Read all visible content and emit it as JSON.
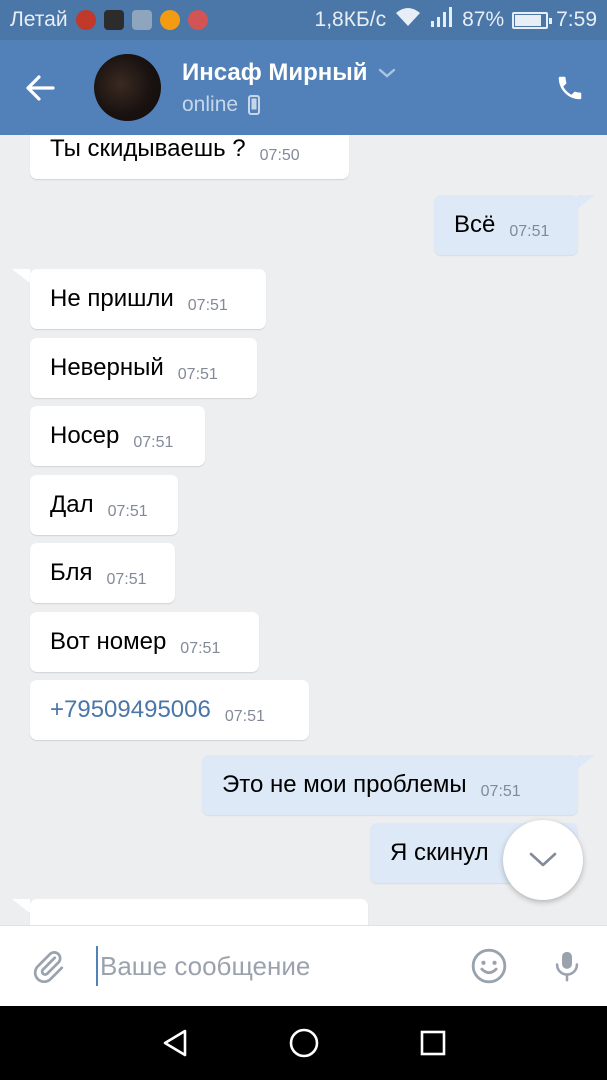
{
  "status_bar": {
    "carrier": "Летай",
    "network_speed": "1,8КБ/с",
    "battery_percent": "87%",
    "battery_level": 0.87,
    "time": "7:59"
  },
  "header": {
    "contact_name": "Инсаф Мирный",
    "status": "online"
  },
  "messages": [
    {
      "direction": "in",
      "text": "Ты скидываешь ?",
      "time": "07:50"
    },
    {
      "direction": "out",
      "text": "Всё",
      "time": "07:51"
    },
    {
      "direction": "in",
      "text": "Не пришли",
      "time": "07:51"
    },
    {
      "direction": "in",
      "text": "Неверный",
      "time": "07:51"
    },
    {
      "direction": "in",
      "text": "Носер",
      "time": "07:51"
    },
    {
      "direction": "in",
      "text": "Дал",
      "time": "07:51"
    },
    {
      "direction": "in",
      "text": "Бля",
      "time": "07:51"
    },
    {
      "direction": "in",
      "text": "Вот номер",
      "time": "07:51"
    },
    {
      "direction": "in",
      "text": "+79509495006",
      "time": "07:51",
      "is_link": true
    },
    {
      "direction": "out",
      "text": "Это не мои проблемы",
      "time": "07:51"
    },
    {
      "direction": "out",
      "text": "Я скинул",
      "time": ""
    },
    {
      "direction": "in",
      "text": "",
      "time": ""
    }
  ],
  "input": {
    "placeholder": "Ваше сообщение"
  },
  "colors": {
    "header": "#5181b8",
    "status_bar": "#4a76a8",
    "background": "#edeef0",
    "outgoing_bubble": "#dde9f7",
    "incoming_bubble": "#ffffff",
    "link": "#4a76a8"
  }
}
